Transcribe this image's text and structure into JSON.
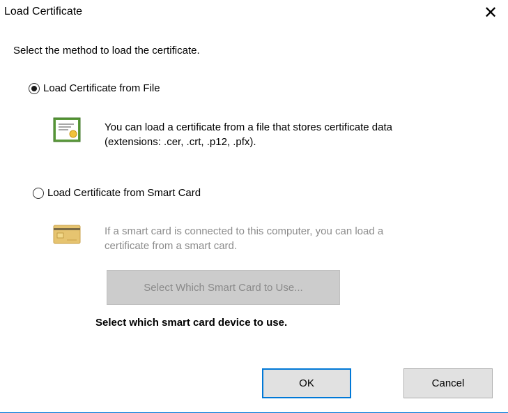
{
  "window": {
    "title": "Load Certificate",
    "close_glyph": "✕"
  },
  "instruction": "Select the method to load the certificate.",
  "options": {
    "file": {
      "label": "Load Certificate from File",
      "selected": true,
      "icon": "certificate-icon",
      "desc_line1": "You can load a certificate from a file that stores certificate data",
      "desc_line2": "(extensions: .cer, .crt, .p12, .pfx)."
    },
    "smartcard": {
      "label": "Load Certificate from Smart Card",
      "selected": false,
      "icon": "smart-card-icon",
      "desc_line1": "If a smart card is connected to this computer, you can load a",
      "desc_line2": "certificate from a smart card.",
      "select_button": "Select Which Smart Card to Use...",
      "note": "Select which smart card device to use."
    }
  },
  "buttons": {
    "ok": "OK",
    "cancel": "Cancel"
  },
  "colors": {
    "accent": "#0078d7",
    "disabled_text": "#8c8c8c",
    "cert_green": "#4a8a2a",
    "card_gold": "#d9b25a"
  }
}
